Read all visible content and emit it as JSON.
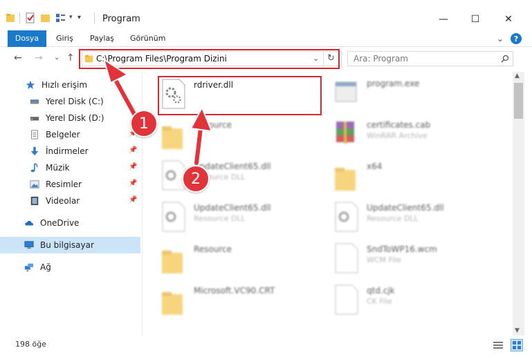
{
  "window": {
    "title": "Program",
    "minimize": "—",
    "maximize": "☐",
    "close": "✕"
  },
  "ribbon": {
    "tabs": [
      "Dosya",
      "Giriş",
      "Paylaş",
      "Görünüm"
    ],
    "help": "?",
    "collapse": "⌄"
  },
  "nav": {
    "back": "←",
    "forward": "→",
    "recent": "⌄",
    "up": "↑",
    "address": "C:\\Program Files\\Program Dizini",
    "refresh": "↻",
    "dropdown": "⌄"
  },
  "search": {
    "placeholder": "Ara: Program",
    "icon": "search-icon"
  },
  "sidebar": {
    "items": [
      {
        "label": "Hızlı erişim",
        "icon": "star-icon"
      },
      {
        "label": "Yerel Disk (C:)",
        "icon": "drive-icon"
      },
      {
        "label": "Yerel Disk (D:)",
        "icon": "drive-icon"
      },
      {
        "label": "Belgeler",
        "icon": "documents-icon"
      },
      {
        "label": "İndirmeler",
        "icon": "download-icon"
      },
      {
        "label": "Müzik",
        "icon": "music-icon"
      },
      {
        "label": "Resimler",
        "icon": "pictures-icon"
      },
      {
        "label": "Videolar",
        "icon": "video-icon"
      },
      {
        "label": "OneDrive",
        "icon": "cloud-icon"
      },
      {
        "label": "Bu bilgisayar",
        "icon": "computer-icon"
      },
      {
        "label": "Ağ",
        "icon": "network-icon"
      }
    ]
  },
  "files": [
    {
      "name": "rdriver.dll",
      "type": "",
      "icon": "dll-icon"
    },
    {
      "name": "program.exe",
      "type": "",
      "icon": "exe-icon"
    },
    {
      "name": "Resource",
      "type": "",
      "icon": "folder-icon"
    },
    {
      "name": "certificates.cab",
      "type": "WinRAR Archive",
      "icon": "archive-icon"
    },
    {
      "name": "UpdateClient65.dll",
      "type": "Resource DLL",
      "icon": "dll-icon"
    },
    {
      "name": "x64",
      "type": "",
      "icon": "folder-icon"
    },
    {
      "name": "UpdateClient65.dll",
      "type": "Resource DLL",
      "icon": "dll-icon"
    },
    {
      "name": "UpdateClient65.dll",
      "type": "Resource DLL",
      "icon": "dll-icon"
    },
    {
      "name": "Resource",
      "type": "",
      "icon": "folder-icon"
    },
    {
      "name": "SndToWP16.wcm",
      "type": "WCM File",
      "icon": "file-icon"
    },
    {
      "name": "Microsoft.VC90.CRT",
      "type": "",
      "icon": "folder-icon"
    },
    {
      "name": "qtd.cjk",
      "type": "CK File",
      "icon": "file-icon"
    }
  ],
  "status": {
    "count": "198 öğe"
  },
  "annotations": {
    "step1": "1",
    "step2": "2"
  }
}
